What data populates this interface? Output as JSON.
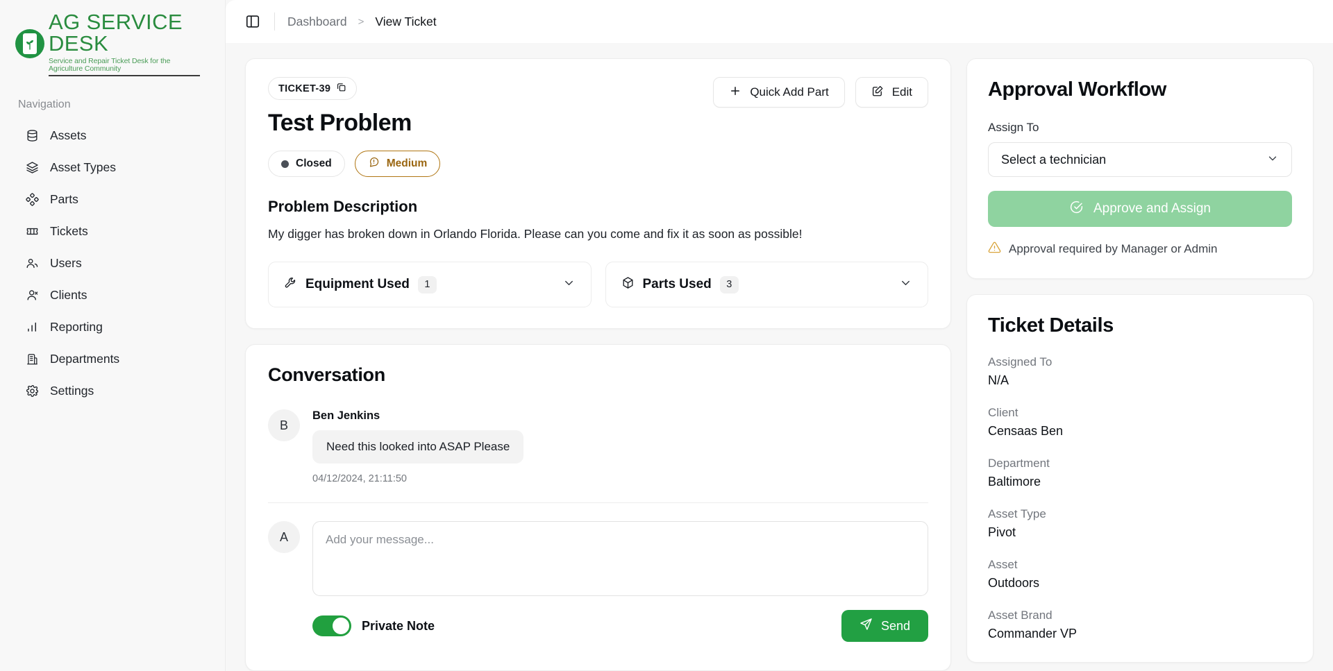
{
  "brand": {
    "title": "AG SERVICE DESK",
    "tagline": "Service and Repair Ticket Desk for the Agriculture Community",
    "green": "#2a8c3f"
  },
  "sidebar": {
    "nav_heading": "Navigation",
    "items": [
      {
        "label": "Assets",
        "icon": "database-icon"
      },
      {
        "label": "Asset Types",
        "icon": "layers-icon"
      },
      {
        "label": "Parts",
        "icon": "parts-icon"
      },
      {
        "label": "Tickets",
        "icon": "ticket-icon"
      },
      {
        "label": "Users",
        "icon": "users-icon"
      },
      {
        "label": "Clients",
        "icon": "client-icon"
      },
      {
        "label": "Reporting",
        "icon": "bar-chart-icon"
      },
      {
        "label": "Departments",
        "icon": "building-icon"
      },
      {
        "label": "Settings",
        "icon": "gear-icon"
      }
    ]
  },
  "topbar": {
    "panel_toggle_icon": "panel-left-icon",
    "breadcrumb": {
      "parent": "Dashboard",
      "separator": ">",
      "current": "View Ticket"
    }
  },
  "ticket": {
    "id": "TICKET-39",
    "copy_icon": "copy-icon",
    "title": "Test Problem",
    "status": {
      "label": "Closed",
      "color": "#4a4f57"
    },
    "priority": {
      "label": "Medium",
      "color": "#9a6611",
      "icon": "alert-message-icon"
    },
    "actions": {
      "quick_add_part": "Quick Add Part",
      "quick_add_part_icon": "plus-icon",
      "edit": "Edit",
      "edit_icon": "pencil-square-icon"
    },
    "description_heading": "Problem Description",
    "description": "My digger has broken down in Orlando Florida. Please can you come and fix it as soon as possible!",
    "accordions": [
      {
        "label": "Equipment Used",
        "count": "1",
        "icon": "wrench-icon",
        "chevron": "chevron-down-icon"
      },
      {
        "label": "Parts Used",
        "count": "3",
        "icon": "box-icon",
        "chevron": "chevron-down-icon"
      }
    ]
  },
  "conversation": {
    "heading": "Conversation",
    "messages": [
      {
        "initial": "B",
        "author": "Ben Jenkins",
        "text": "Need this looked into ASAP Please",
        "timestamp": "04/12/2024, 21:11:50"
      }
    ],
    "composer": {
      "initial": "A",
      "placeholder": "Add your message...",
      "value": "",
      "private_note_label": "Private Note",
      "private_note_on": true,
      "send_label": "Send",
      "send_icon": "send-icon"
    }
  },
  "approval": {
    "heading": "Approval Workflow",
    "assign_label": "Assign To",
    "assign_value": "Select a technician",
    "assign_chevron": "chevron-down-icon",
    "approve_label": "Approve and Assign",
    "approve_icon": "check-circle-icon",
    "approve_color": "#8fd3a0",
    "note": "Approval required by Manager or Admin",
    "note_icon": "warning-triangle-icon",
    "note_icon_color": "#d9a43a"
  },
  "details": {
    "heading": "Ticket Details",
    "rows": [
      {
        "label": "Assigned To",
        "value": "N/A"
      },
      {
        "label": "Client",
        "value": "Censaas Ben"
      },
      {
        "label": "Department",
        "value": "Baltimore"
      },
      {
        "label": "Asset Type",
        "value": "Pivot"
      },
      {
        "label": "Asset",
        "value": "Outdoors"
      },
      {
        "label": "Asset Brand",
        "value": "Commander VP"
      }
    ]
  }
}
